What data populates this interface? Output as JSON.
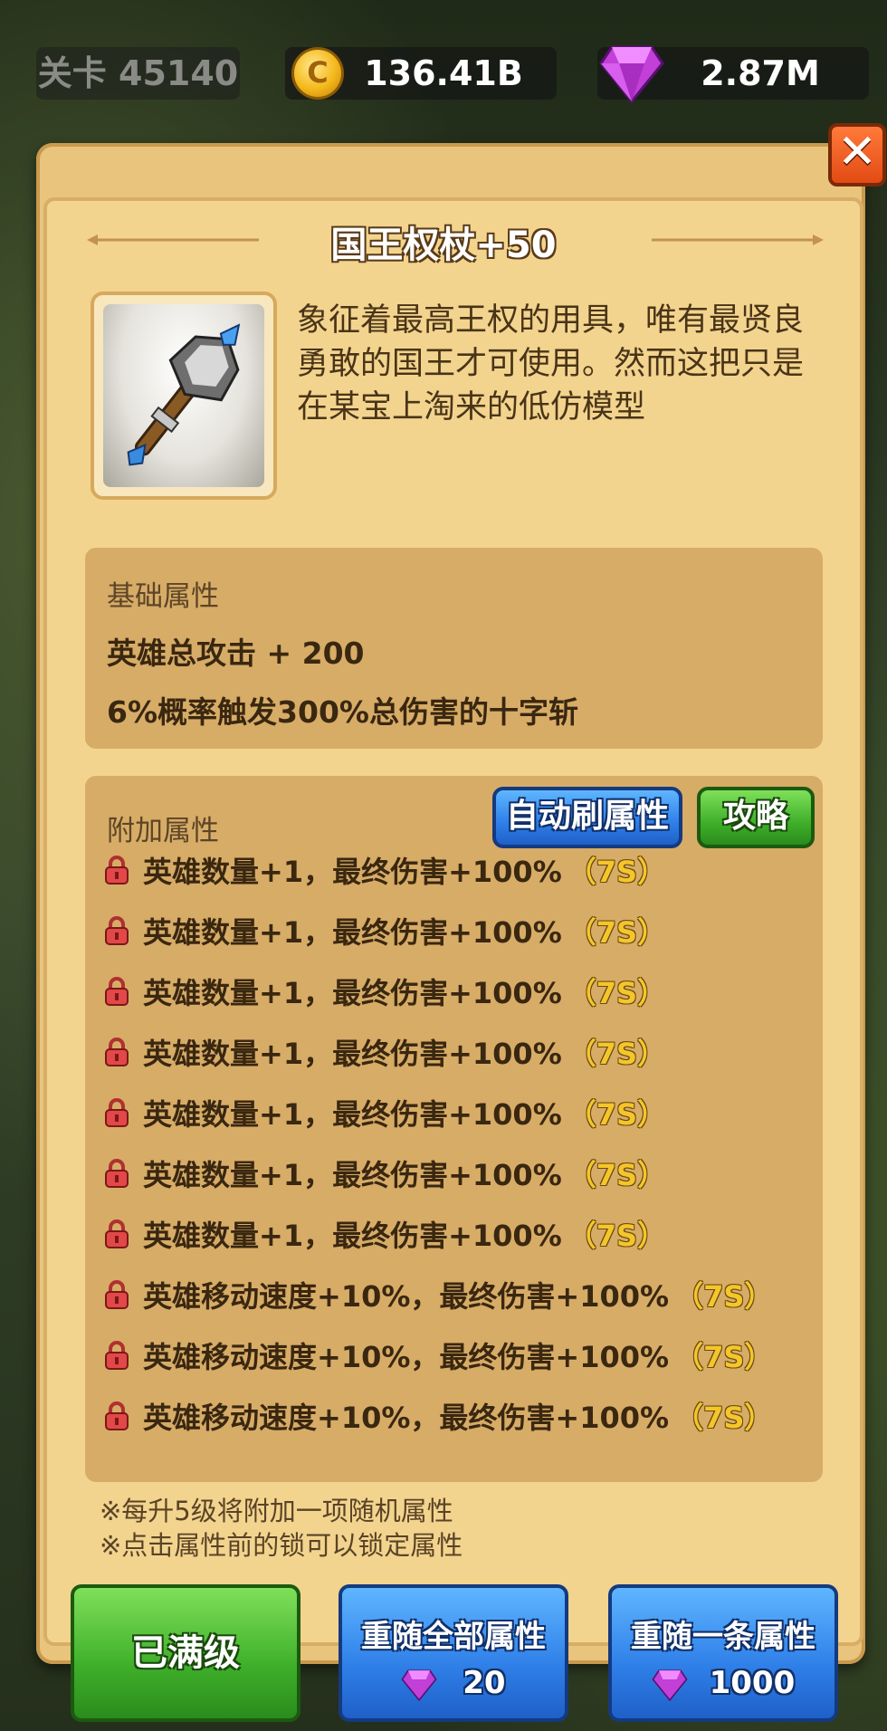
{
  "topbar": {
    "level": "关卡 45140",
    "coin_icon_glyph": "C",
    "coins": "136.41B",
    "gems": "2.87M"
  },
  "panel": {
    "title": "国王权杖+50",
    "close_glyph": "✕",
    "description_lines": [
      "象征着最高王权的用具，唯有最贤良",
      "勇敢的国王才可使用。然而这把只是",
      "在某宝上淘来的低仿模型"
    ]
  },
  "base_attributes": {
    "label": "基础属性",
    "lines": [
      "英雄总攻击 + 200",
      "6%概率触发300%总伤害的十字斩"
    ]
  },
  "extra_attributes": {
    "label": "附加属性",
    "auto_refresh_button": "自动刷属性",
    "guide_button": "攻略",
    "rows": [
      {
        "text": "英雄数量+1，最终伤害+100%",
        "tag": "（7S）"
      },
      {
        "text": "英雄数量+1，最终伤害+100%",
        "tag": "（7S）"
      },
      {
        "text": "英雄数量+1，最终伤害+100%",
        "tag": "（7S）"
      },
      {
        "text": "英雄数量+1，最终伤害+100%",
        "tag": "（7S）"
      },
      {
        "text": "英雄数量+1，最终伤害+100%",
        "tag": "（7S）"
      },
      {
        "text": "英雄数量+1，最终伤害+100%",
        "tag": "（7S）"
      },
      {
        "text": "英雄数量+1，最终伤害+100%",
        "tag": "（7S）"
      },
      {
        "text": "英雄移动速度+10%，最终伤害+100%",
        "tag": "（7S）"
      },
      {
        "text": "英雄移动速度+10%，最终伤害+100%",
        "tag": "（7S）"
      },
      {
        "text": "英雄移动速度+10%，最终伤害+100%",
        "tag": "（7S）"
      }
    ]
  },
  "notes": [
    "※每升5级将附加一项随机属性",
    "※点击属性前的锁可以锁定属性"
  ],
  "footer": {
    "max_level_button": "已满级",
    "reroll_all_button": "重随全部属性",
    "reroll_all_cost": "20",
    "reroll_one_button": "重随一条属性",
    "reroll_one_cost": "1000"
  },
  "colors": {
    "panel": "#f2d48e",
    "box": "#d7ac67",
    "tag": "#f5c62a",
    "blue_button": "#2f7fe8",
    "green_button": "#3faf2a"
  }
}
